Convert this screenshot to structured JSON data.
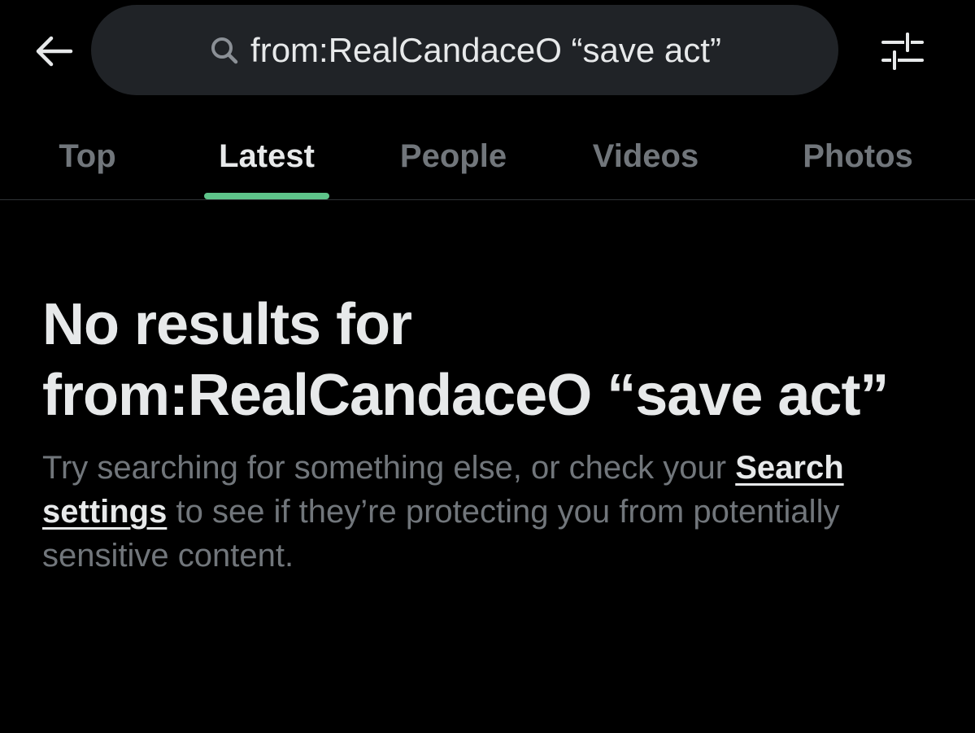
{
  "header": {
    "back_icon": "arrow-left-icon",
    "search": {
      "icon": "search-icon",
      "query": "from:RealCandaceO “save act”"
    },
    "filter_icon": "sliders-icon"
  },
  "tabs": [
    {
      "label": "Top",
      "active": false
    },
    {
      "label": "Latest",
      "active": true
    },
    {
      "label": "People",
      "active": false
    },
    {
      "label": "Videos",
      "active": false
    },
    {
      "label": "Photos",
      "active": false
    }
  ],
  "empty_state": {
    "title": "No results for from:RealCandaceO “save act”",
    "body_before_link": "Try searching for something else, or check your ",
    "link_label": "Search settings",
    "body_after_link": " to see if they’re protecting you from potentially sensitive content."
  },
  "colors": {
    "background": "#000000",
    "pill": "#202327",
    "text_primary": "#e7e9ea",
    "text_secondary": "#71767b",
    "accent": "#5ec48a",
    "divider": "#2f3336"
  }
}
